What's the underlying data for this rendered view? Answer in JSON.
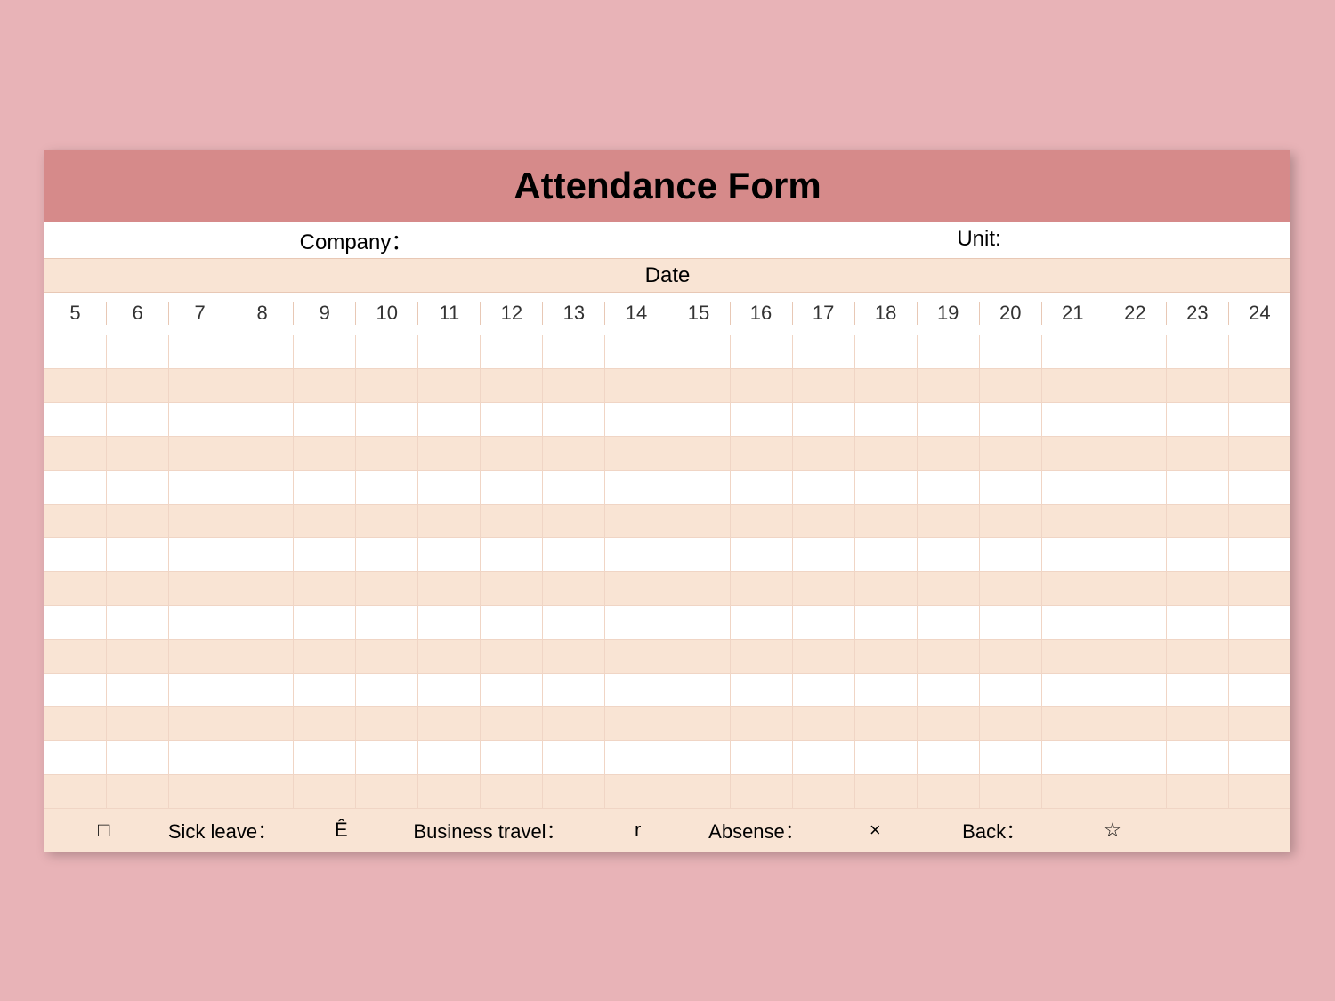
{
  "title": "Attendance Form",
  "info": {
    "company_label": "Company：",
    "unit_label": "Unit:"
  },
  "date_label": "Date",
  "days": [
    "5",
    "6",
    "7",
    "8",
    "9",
    "10",
    "11",
    "12",
    "13",
    "14",
    "15",
    "16",
    "17",
    "18",
    "19",
    "20",
    "21",
    "22",
    "23",
    "24"
  ],
  "row_count": 14,
  "legend": {
    "sym1": "□",
    "sick_label": "Sick leave：",
    "sym2": "Ê",
    "travel_label": "Business travel：",
    "sym3": "r",
    "absence_label": "Absense：",
    "sym4": "×",
    "back_label": "Back：",
    "sym5": "☆"
  }
}
